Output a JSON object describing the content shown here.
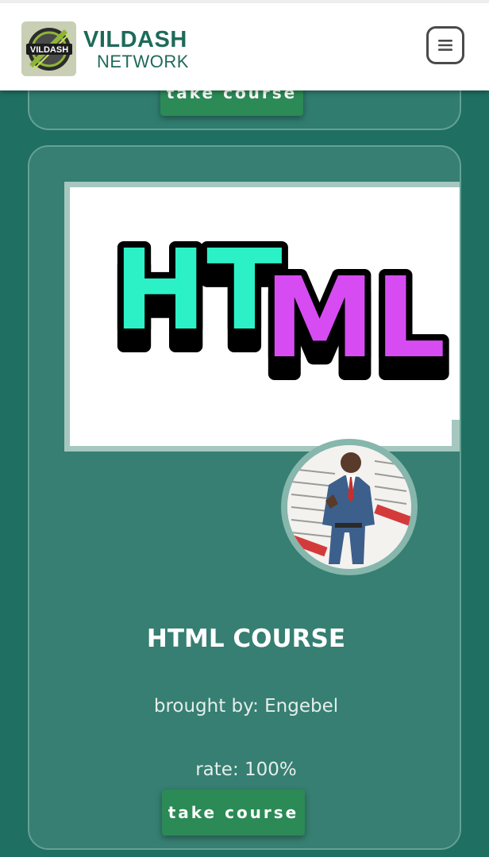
{
  "header": {
    "logo_text": "VILDASH",
    "title": "VILDASH",
    "subtitle": "NETWORK",
    "menu_icon": "hamburger-menu-icon"
  },
  "previous_card": {
    "button_label": "take course"
  },
  "course": {
    "image_text": "HTML",
    "title": "HTML COURSE",
    "author": "brought by: Engebel",
    "rate": "rate: 100%",
    "button_label": "take course"
  },
  "colors": {
    "background": "#1f6f62",
    "card": "#367f72",
    "button": "#2b8a55",
    "brand": "#1e6a5a"
  }
}
